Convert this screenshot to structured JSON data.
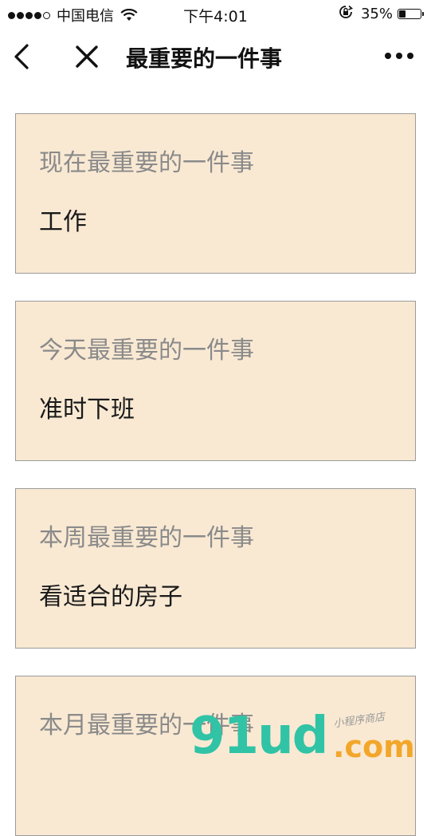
{
  "status_bar": {
    "carrier": "中国电信",
    "time": "下午4:01",
    "battery_percent": "35%",
    "battery_level": 0.35,
    "signal_bars_filled": 4,
    "signal_bars_total": 5
  },
  "nav": {
    "title": "最重要的一件事"
  },
  "cards": [
    {
      "label": "现在最重要的一件事",
      "value": "工作"
    },
    {
      "label": "今天最重要的一件事",
      "value": "准时下班"
    },
    {
      "label": "本周最重要的一件事",
      "value": "看适合的房子"
    },
    {
      "label": "本月最重要的一件事",
      "value": ""
    }
  ],
  "watermark": {
    "main": "91ud",
    "com": ".com",
    "sub": "小程序商店"
  },
  "colors": {
    "card_background": "#f9e9d3",
    "card_border": "#9a9a9a",
    "label_text": "#8a8a8a",
    "value_text": "#1a1a1a",
    "watermark_green": "#31c3a6",
    "watermark_orange": "#f2a72b"
  },
  "icons": {
    "back": "chevron-left-icon",
    "close": "close-icon",
    "more": "more-dots-icon",
    "wifi": "wifi-icon",
    "orientation_lock": "orientation-lock-icon",
    "battery": "battery-icon"
  }
}
